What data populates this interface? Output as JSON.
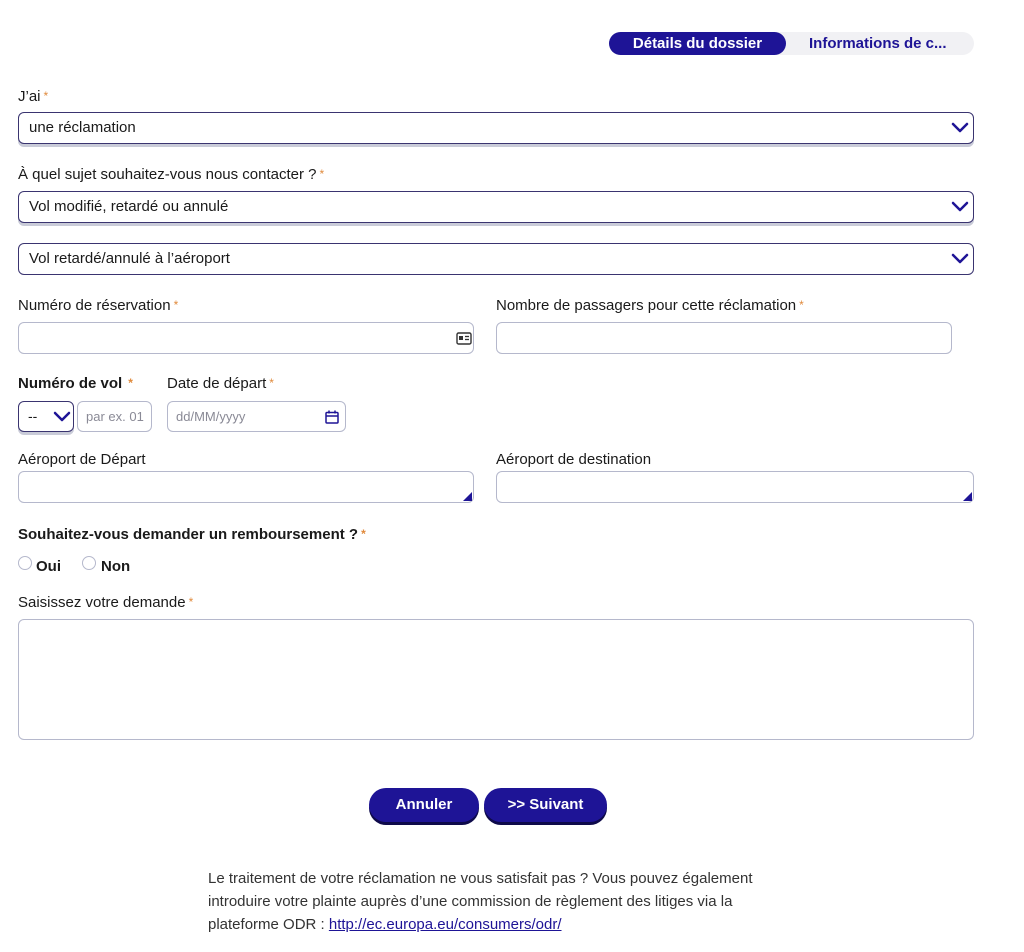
{
  "tabs": {
    "active": "Détails du dossier",
    "inactive": "Informations de c..."
  },
  "form": {
    "jai": {
      "label": "J’ai",
      "value": "une réclamation"
    },
    "sujet": {
      "label": "À quel sujet souhaitez-vous nous contacter ?",
      "value": "Vol modifié, retardé ou annulé"
    },
    "sous_sujet": {
      "value": "Vol retardé/annulé à l’aéroport"
    },
    "reservation": {
      "label": "Numéro de réservation",
      "value": ""
    },
    "passagers": {
      "label": "Nombre de passagers pour cette réclamation",
      "value": ""
    },
    "numero_vol": {
      "label": "Numéro de vol",
      "prefix_value": "--",
      "placeholder": "par ex. 01"
    },
    "date_depart": {
      "label": "Date de départ",
      "placeholder": "dd/MM/yyyy"
    },
    "aeroport_depart": {
      "label": "Aéroport de Départ",
      "value": ""
    },
    "aeroport_destination": {
      "label": "Aéroport de destination",
      "value": ""
    },
    "remboursement": {
      "label": "Souhaitez-vous demander un remboursement ?",
      "options": [
        "Oui",
        "Non"
      ]
    },
    "demande": {
      "label": "Saisissez votre demande",
      "value": ""
    },
    "required_mark": "*"
  },
  "buttons": {
    "cancel": "Annuler",
    "next": ">> Suivant"
  },
  "footer": {
    "text": "Le traitement de votre réclamation ne vous satisfait pas ? Vous pouvez également introduire votre plainte auprès d’une commission de règlement des litiges via la plateforme ODR : ",
    "link": "http://ec.europa.eu/consumers/odr/"
  },
  "colors": {
    "primary": "#1e1496",
    "required_star": "#e08a3c",
    "border": "#b5b8cc"
  },
  "icons": {
    "select_arrow": "chevron-down-icon",
    "reservation_field": "id-card-icon",
    "date_field": "calendar-icon",
    "airport_field": "autocomplete-corner-icon"
  }
}
